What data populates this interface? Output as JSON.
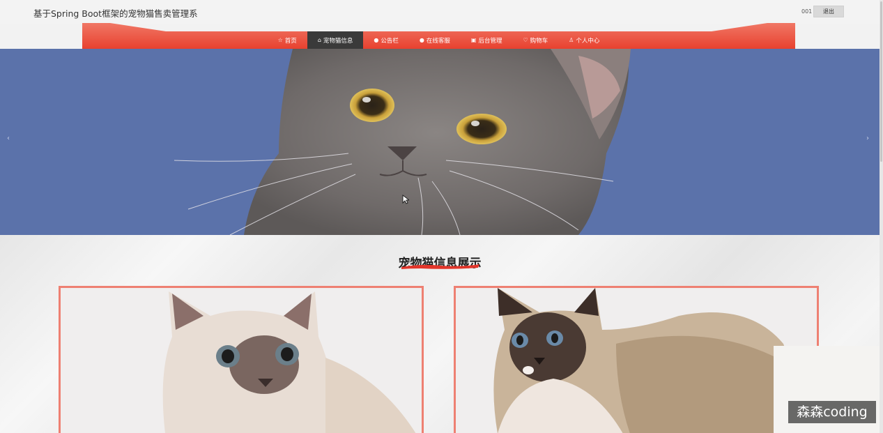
{
  "header": {
    "site_title": "基于Spring Boot框架的宠物猫售卖管理系",
    "user_id": "001",
    "logout_label": "退出"
  },
  "nav": {
    "items": [
      {
        "label": "首页",
        "icon": "star-icon"
      },
      {
        "label": "宠物猫信息",
        "icon": "bag-icon"
      },
      {
        "label": "公告栏",
        "icon": "info-icon"
      },
      {
        "label": "在线客服",
        "icon": "question-icon"
      },
      {
        "label": "后台管理",
        "icon": "gift-icon"
      },
      {
        "label": "购物车",
        "icon": "cart-icon"
      },
      {
        "label": "个人中心",
        "icon": "user-icon"
      }
    ],
    "active_index": 1
  },
  "banner": {
    "prev_label": "‹",
    "next_label": "›"
  },
  "section": {
    "title": "宠物猫信息展示"
  },
  "watermark": "森森coding",
  "colors": {
    "accent": "#ee5a45",
    "nav_active": "#3a3a3a",
    "banner_bg": "#5b72aa",
    "card_border": "#ee8072"
  }
}
